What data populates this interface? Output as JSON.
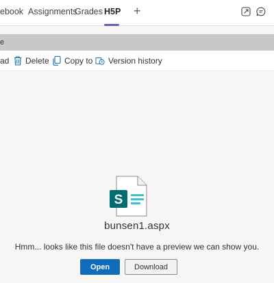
{
  "tabs": [
    {
      "label": "ebook"
    },
    {
      "label": "Assignments"
    },
    {
      "label": "Grades"
    },
    {
      "label": "H5P",
      "active": true
    }
  ],
  "icons": {
    "add_tab": "plus-icon",
    "popout": "popout-icon",
    "chat": "chat-icon",
    "delete": "trash-icon",
    "copy": "copy-icon",
    "version": "version-history-icon",
    "file": "sharepoint-page-file-icon"
  },
  "greyband": {
    "text": "e"
  },
  "toolbar": {
    "partial_label": "ad",
    "delete_label": "Delete",
    "copy_label": "Copy to",
    "version_label": "Version history"
  },
  "preview": {
    "file_name": "bunsen1.aspx",
    "message": "Hmm... looks like this file doesn't have a preview we can show you.",
    "open_label": "Open",
    "download_label": "Download",
    "file_icon_letter": "S"
  },
  "colors": {
    "accent": "#5b5fc7",
    "primary_button": "#0f6cbd",
    "sharepoint_teal": "#036c70",
    "sharepoint_teal_light": "#37c6d0"
  }
}
